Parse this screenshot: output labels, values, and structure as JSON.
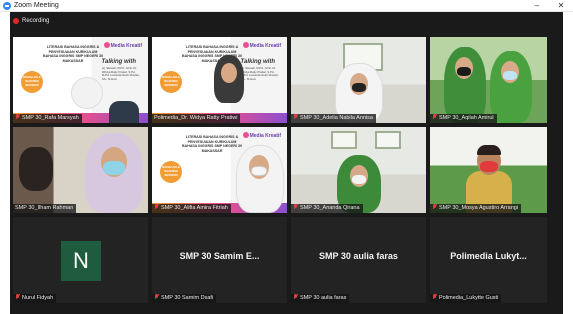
{
  "window": {
    "title": "Zoom Meeting",
    "minimize_glyph": "–",
    "close_glyph": "✕"
  },
  "meeting": {
    "recording_label": "Recording"
  },
  "slides": {
    "title_lines": "LITERASI BAHASA INGGRIS & PENYESUAIAN KURIKULUM BAHASA INGGRIS SMP NEGERI 30 MAKASSAR",
    "logo": "Media Kreatif",
    "talking_with": "Talking with",
    "pill": "KENALAN & SHARING SESSION",
    "names": "Hj. Sanaeb, M.Pd., M.Si. Dr. Wildya Ratty Pratiwi, S.Pd., M.Pd. Lusianda Noeh Mustari, SS., M.Hum"
  },
  "participants": [
    {
      "name": "SMP 30_Rafa Marsyah",
      "muted": true
    },
    {
      "name": "Polimedia_Dr. Widya Ratty Pratiwi",
      "muted": false
    },
    {
      "name": "SMP 30_Adelia Nabila Annisa",
      "muted": true
    },
    {
      "name": "SMP 30_Aqilah Amirul",
      "muted": true
    },
    {
      "name": "SMP 30_Ilham Rahman",
      "muted": false
    },
    {
      "name": "SMP 30_Alifia Amira Fitriah",
      "muted": true
    },
    {
      "name": "SMP 30_Ananda Qirana",
      "muted": true
    },
    {
      "name": "SMP 30_Mosya Agustiro Arrangi",
      "muted": true
    },
    {
      "name": "Nurul Fidyah",
      "muted": true,
      "display": "N"
    },
    {
      "name": "SMP 30 Samim Dsafi",
      "muted": true,
      "display": "SMP 30 Samim E..."
    },
    {
      "name": "SMP 30 aulia faras",
      "muted": true,
      "display": "SMP 30 aulia faras"
    },
    {
      "name": "Polimedia_Lukytte Gusti",
      "muted": true,
      "display": "Polimedia  Lukyt..."
    }
  ],
  "colors": {
    "active_speaker": "#c3d55a",
    "recording": "#e02828",
    "avatar_bg": "#1e5b3f",
    "stage_bg": "#1a1a1a"
  }
}
